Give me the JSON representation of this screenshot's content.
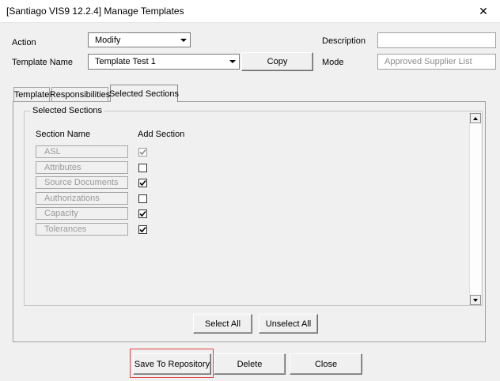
{
  "window": {
    "title": "[Santiago VIS9 12.2.4] Manage Templates",
    "close_symbol": "✕"
  },
  "form": {
    "action_label": "Action",
    "action_value": "Modify",
    "template_name_label": "Template Name",
    "template_name_value": "Template Test 1",
    "copy_button": "Copy",
    "description_label": "Description",
    "description_value": "",
    "mode_label": "Mode",
    "mode_value": "Approved Supplier List"
  },
  "tabs": [
    {
      "label": "Template",
      "active": false
    },
    {
      "label": "Responsibilities",
      "active": false
    },
    {
      "label": "Selected Sections",
      "active": true
    }
  ],
  "selected_sections": {
    "group_title": "Selected Sections",
    "col_section_name": "Section Name",
    "col_add_section": "Add Section",
    "rows": [
      {
        "name": "ASL",
        "checked": true,
        "disabled": true
      },
      {
        "name": "Attributes",
        "checked": false,
        "disabled": false
      },
      {
        "name": "Source Documents",
        "checked": true,
        "disabled": false
      },
      {
        "name": "Authorizations",
        "checked": false,
        "disabled": false
      },
      {
        "name": "Capacity",
        "checked": true,
        "disabled": false
      },
      {
        "name": "Tolerances",
        "checked": true,
        "disabled": false
      }
    ],
    "select_all_button": "Select All",
    "unselect_all_button": "Unselect All"
  },
  "footer": {
    "save_button": "Save To Repository",
    "delete_button": "Delete",
    "close_button": "Close"
  },
  "colors": {
    "highlight": "#e04040"
  }
}
